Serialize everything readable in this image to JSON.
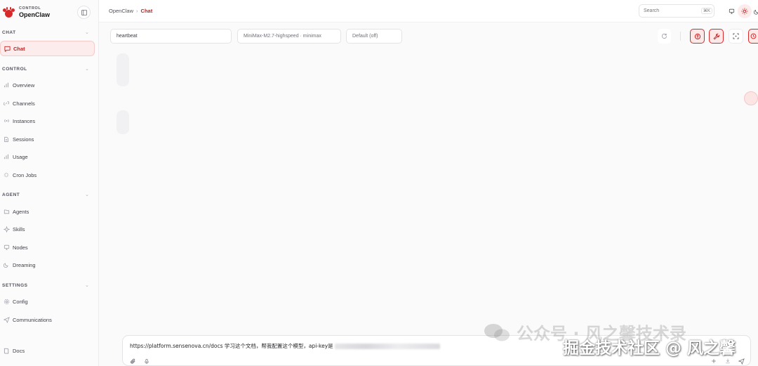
{
  "brand": {
    "small": "CONTROL",
    "name": "OpenClaw"
  },
  "sidebar": {
    "sections": [
      {
        "label": "CHAT",
        "items": [
          {
            "label": "Chat",
            "icon": "message-icon",
            "active": true
          }
        ]
      },
      {
        "label": "CONTROL",
        "items": [
          {
            "label": "Overview",
            "icon": "bar-chart-icon"
          },
          {
            "label": "Channels",
            "icon": "link-icon"
          },
          {
            "label": "Instances",
            "icon": "radio-icon"
          },
          {
            "label": "Sessions",
            "icon": "file-icon"
          },
          {
            "label": "Usage",
            "icon": "bar-chart-icon"
          },
          {
            "label": "Cron Jobs",
            "icon": "loader-icon"
          }
        ]
      },
      {
        "label": "AGENT",
        "items": [
          {
            "label": "Agents",
            "icon": "folder-icon"
          },
          {
            "label": "Skills",
            "icon": "sparkle-icon"
          },
          {
            "label": "Nodes",
            "icon": "monitor-icon"
          },
          {
            "label": "Dreaming",
            "icon": "moon-icon"
          }
        ]
      },
      {
        "label": "SETTINGS",
        "items": [
          {
            "label": "Config",
            "icon": "gear-icon"
          },
          {
            "label": "Communications",
            "icon": "send-icon"
          },
          {
            "label": "Docs",
            "icon": "book-icon"
          }
        ]
      }
    ]
  },
  "topbar": {
    "breadcrumb": {
      "root": "OpenClaw",
      "separator": "›",
      "current": "Chat"
    },
    "search": {
      "placeholder": "Search",
      "shortcut": "⌘K"
    }
  },
  "controls": {
    "session": "heartbeat",
    "model": "MiniMax-M2.7-highspeed · minimax",
    "thinking": "Default (off)"
  },
  "composer": {
    "text": "https://platform.sensenova.cn/docs 学习这个文档，帮我配置这个模型，api-key是"
  },
  "watermark": {
    "line1": "公众号 · 风之馨技术录",
    "line2": "掘金技术社区 @ 风之馨"
  },
  "colors": {
    "accent": "#c81e1e",
    "accent_bg": "#fdecec",
    "sidebar_bg": "#fbfbfc"
  }
}
